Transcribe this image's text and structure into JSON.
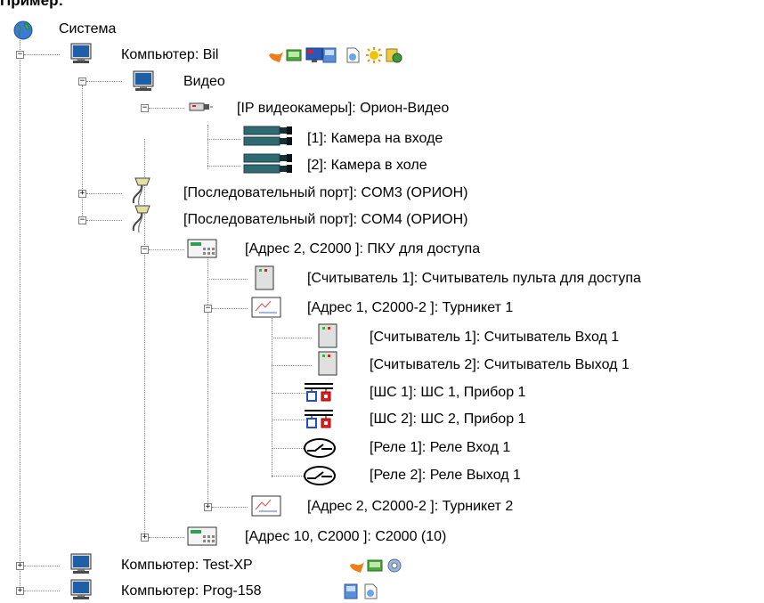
{
  "header": {
    "title": "Пример:"
  },
  "tree": {
    "system": "Система",
    "computer_bil": "Компьютер: Bil",
    "video": "Видео",
    "ip_cameras": "[IP видеокамеры]: Орион-Видео",
    "camera1": "[1]: Камера на входе",
    "camera2": "[2]: Камера в холе",
    "com3": "[Последовательный порт]: COM3 (ОРИОН)",
    "com4": "[Последовательный порт]: COM4 (ОРИОН)",
    "pku": "[Адрес 2, С2000 ]: ПКУ для доступа",
    "reader_pku": "[Считыватель 1]: Считыватель пульта для доступа",
    "turnstile1": "[Адрес 1, С2000-2 ]: Турникет 1",
    "reader_in": "[Считыватель 1]: Считыватель Вход 1",
    "reader_out": "[Считыватель 2]: Считыватель Выход 1",
    "shs1": "[ШС 1]: ШС 1, Прибор 1",
    "shs2": "[ШС 2]: ШС 2, Прибор 1",
    "relay1": "[Реле 1]: Реле Вход 1",
    "relay2": "[Реле 2]: Реле Выход 1",
    "turnstile2": "[Адрес 2, С2000-2 ]: Турникет 2",
    "c2000_10": "[Адрес 10, С2000 ]: С2000 (10)",
    "computer_testxp": "Компьютер: Test-XP",
    "computer_prog158": "Компьютер: Prog-158"
  },
  "expanders": {
    "minus": "−",
    "plus": "+"
  },
  "icons": {
    "globe": "globe-icon",
    "monitor": "monitor-icon",
    "camera": "camera-icon",
    "port": "serial-port-icon",
    "panel": "control-panel-icon",
    "reader": "reader-icon",
    "turnstile": "turnstile-icon",
    "zone": "loop-icon",
    "relay": "relay-icon"
  },
  "colors": {
    "tree_line": "#8a8a8a",
    "monitor_screen": "#1f5fa8",
    "camera_body": "#2f6a73",
    "reader_led_green": "#22c02a",
    "reader_led_red": "#e02020"
  }
}
